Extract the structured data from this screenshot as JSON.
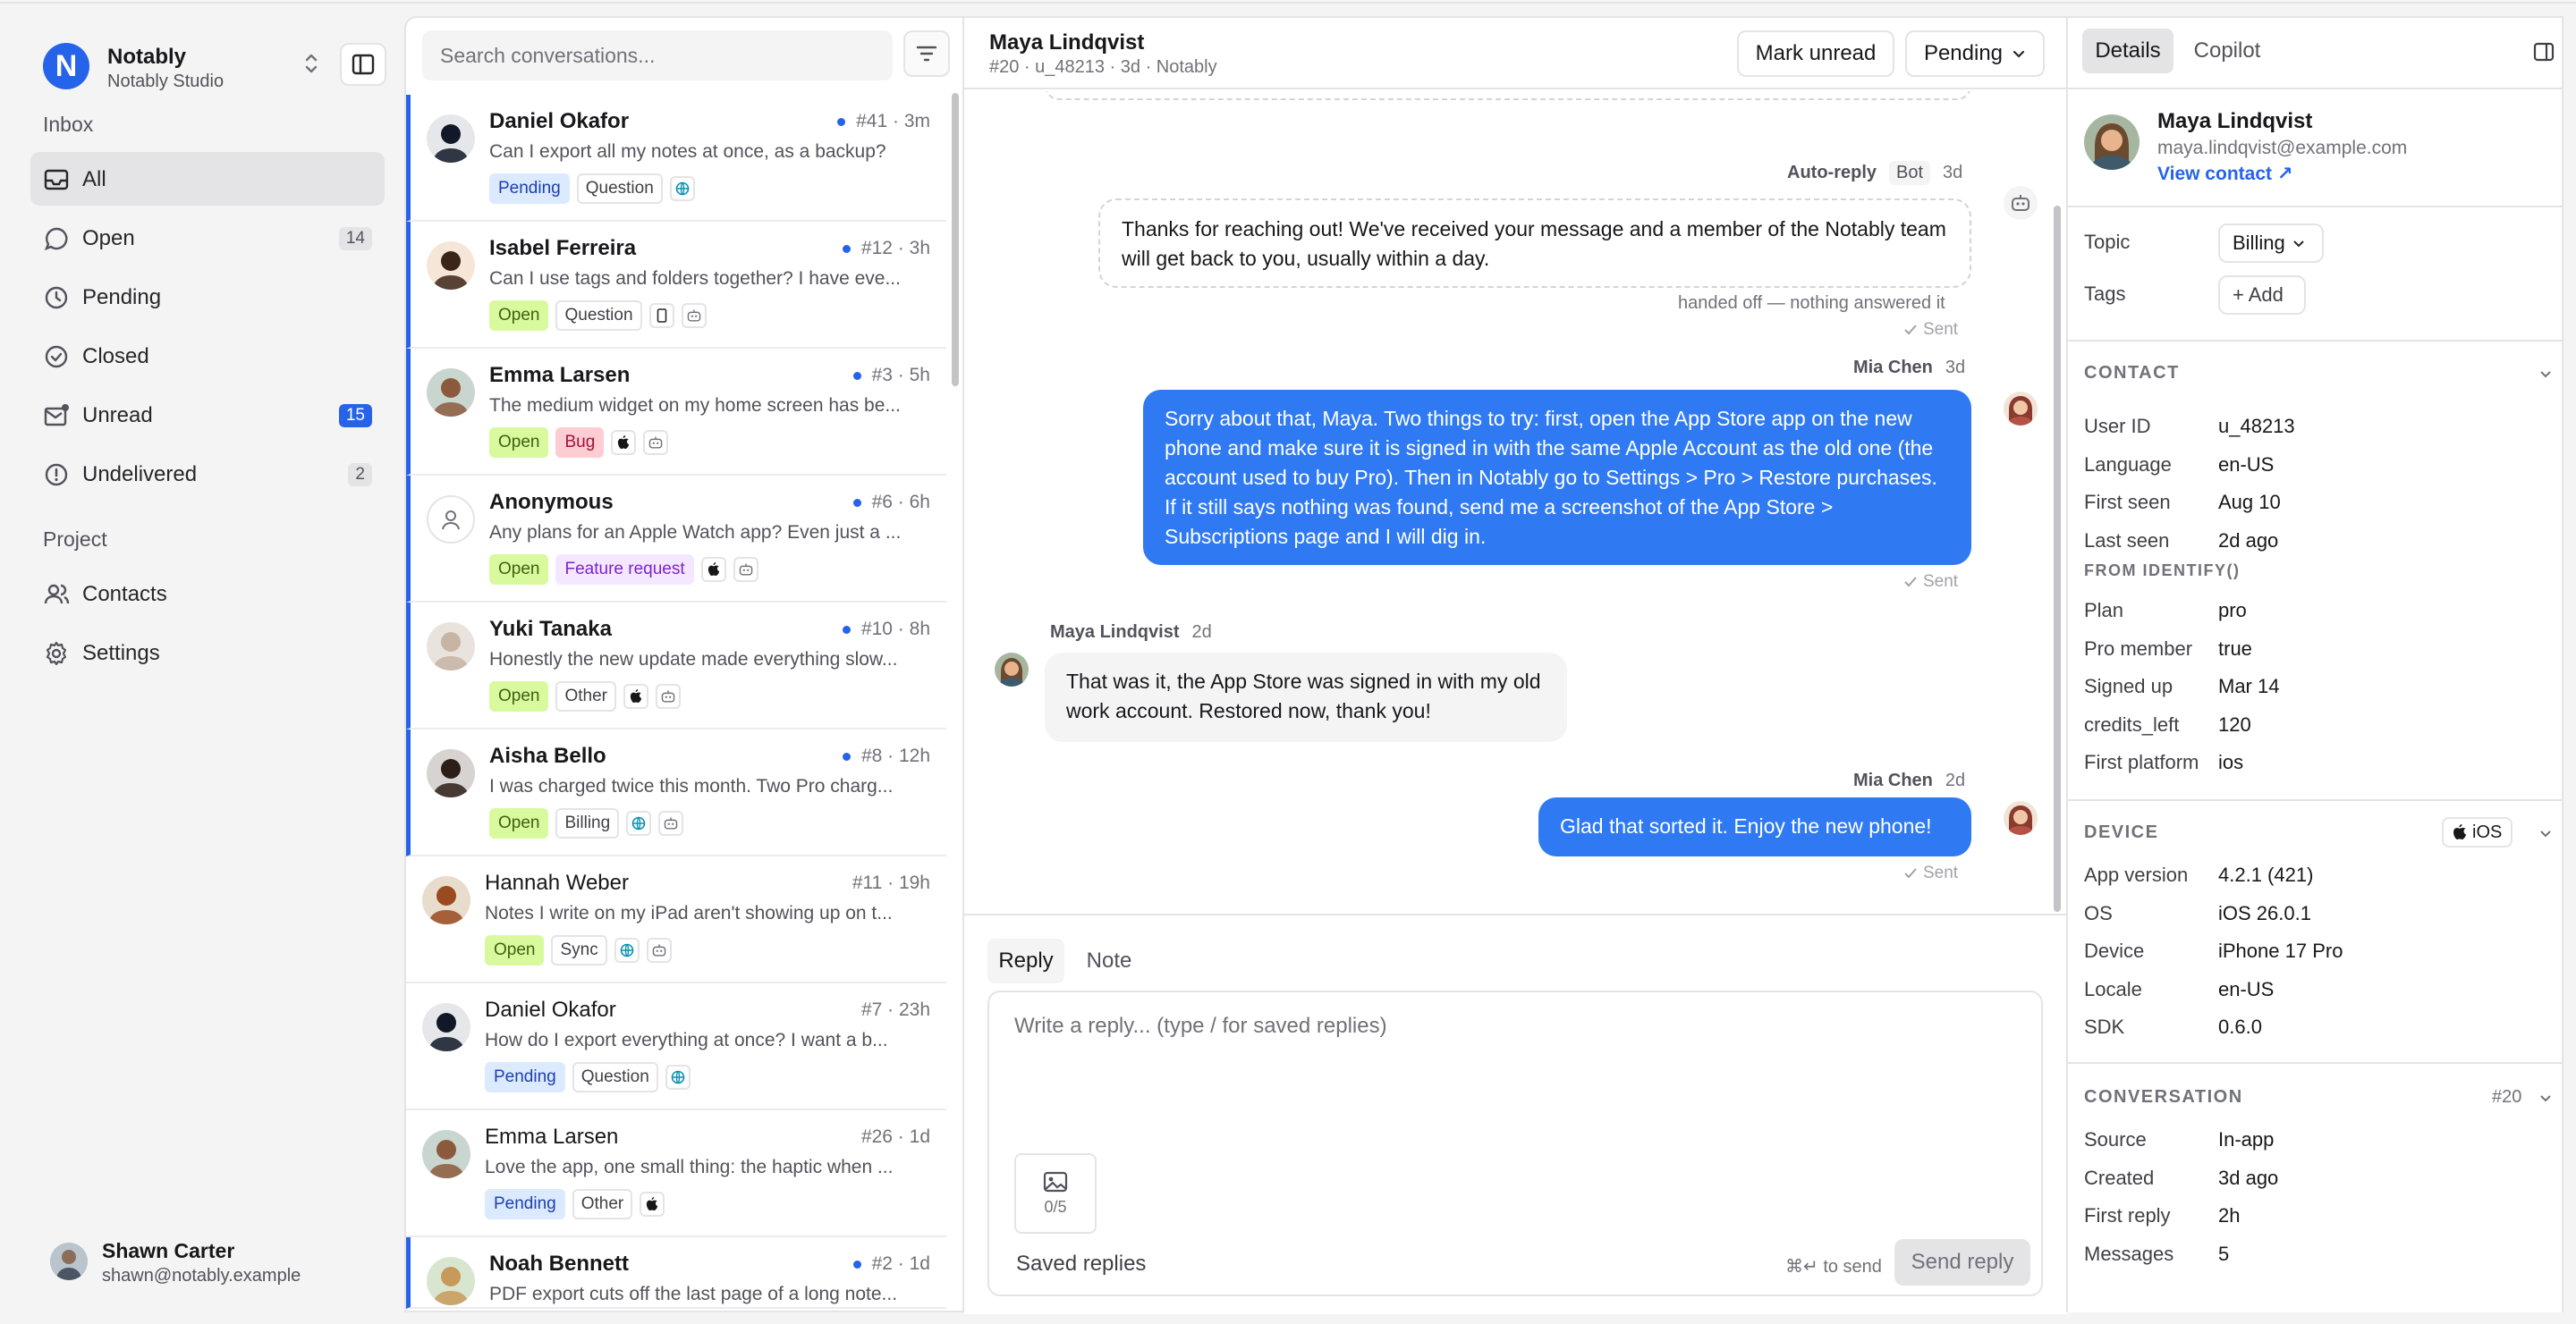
{
  "workspace": {
    "logo_letter": "N",
    "name": "Notably",
    "subtitle": "Notably Studio"
  },
  "sidebar": {
    "inbox_label": "Inbox",
    "items": [
      {
        "label": "All",
        "count": ""
      },
      {
        "label": "Open",
        "count": "14"
      },
      {
        "label": "Pending",
        "count": ""
      },
      {
        "label": "Closed",
        "count": ""
      },
      {
        "label": "Unread",
        "count": "15"
      },
      {
        "label": "Undelivered",
        "count": "2"
      }
    ],
    "project_label": "Project",
    "project_items": [
      {
        "label": "Contacts"
      },
      {
        "label": "Settings"
      }
    ],
    "user": {
      "name": "Shawn Carter",
      "email": "shawn@notably.example"
    }
  },
  "search": {
    "placeholder": "Search conversations..."
  },
  "conversations": [
    {
      "name": "Daniel Okafor",
      "meta": "#41 · 3m",
      "preview": "Can I export all my notes at once, as a backup?",
      "status": "Pending",
      "topic": "Question"
    },
    {
      "name": "Isabel Ferreira",
      "meta": "#12 · 3h",
      "preview": "Can I use tags and folders together? I have eve...",
      "status": "Open",
      "topic": "Question"
    },
    {
      "name": "Emma Larsen",
      "meta": "#3 · 5h",
      "preview": "The medium widget on my home screen has be...",
      "status": "Open",
      "topic": "Bug"
    },
    {
      "name": "Anonymous",
      "meta": "#6 · 6h",
      "preview": "Any plans for an Apple Watch app? Even just a ...",
      "status": "Open",
      "topic": "Feature request"
    },
    {
      "name": "Yuki Tanaka",
      "meta": "#10 · 8h",
      "preview": "Honestly the new update made everything slow...",
      "status": "Open",
      "topic": "Other"
    },
    {
      "name": "Aisha Bello",
      "meta": "#8 · 12h",
      "preview": "I was charged twice this month. Two Pro charg...",
      "status": "Open",
      "topic": "Billing"
    },
    {
      "name": "Hannah Weber",
      "meta": "#11 · 19h",
      "preview": "Notes I write on my iPad aren't showing up on t...",
      "status": "Open",
      "topic": "Sync"
    },
    {
      "name": "Daniel Okafor",
      "meta": "#7 · 23h",
      "preview": "How do I export everything at once? I want a b...",
      "status": "Pending",
      "topic": "Question"
    },
    {
      "name": "Emma Larsen",
      "meta": "#26 · 1d",
      "preview": "Love the app, one small thing: the haptic when ...",
      "status": "Pending",
      "topic": "Other"
    },
    {
      "name": "Noah Bennett",
      "meta": "#2 · 1d",
      "preview": "PDF export cuts off the last page of a long note...",
      "status": "",
      "topic": ""
    }
  ],
  "chat": {
    "title": "Maya Lindqvist",
    "subtitle": "#20 · u_48213 · 3d · Notably",
    "mark_unread": "Mark unread",
    "status": "Pending",
    "auto_label": "Auto-reply",
    "bot_badge": "Bot",
    "auto_time": "3d",
    "auto_text": "Thanks for reaching out! We've received your message and a member of the Notably team will get back to you, usually within a day.",
    "handoff_note": "handed off — nothing answered it",
    "sent": "Sent",
    "agent_name": "Mia Chen",
    "agent_time1": "3d",
    "agent_text1": "Sorry about that, Maya. Two things to try: first, open the App Store app on the new phone and make sure it is signed in with the same Apple Account as the old one (the account used to buy Pro). Then in Notably go to Settings > Pro > Restore purchases. If it still says nothing was found, send me a screenshot of the App Store > Subscriptions page and I will dig in.",
    "user_name": "Maya Lindqvist",
    "user_time": "2d",
    "user_text": "That was it, the App Store was signed in with my old work account. Restored now, thank you!",
    "agent_time2": "2d",
    "agent_text2": "Glad that sorted it. Enjoy the new phone!"
  },
  "composer": {
    "tab_reply": "Reply",
    "tab_note": "Note",
    "placeholder": "Write a reply... (type / for saved replies)",
    "attach_count": "0/5",
    "saved_replies": "Saved replies",
    "send_hint": "⌘↵ to send",
    "send_label": "Send reply"
  },
  "details": {
    "tab_details": "Details",
    "tab_copilot": "Copilot",
    "contact_name": "Maya Lindqvist",
    "contact_email": "maya.lindqvist@example.com",
    "view_contact": "View contact ↗",
    "topic_label": "Topic",
    "topic_value": "Billing",
    "tags_label": "Tags",
    "add_tag": "+ Add",
    "contact_section": "CONTACT",
    "contact_rows": [
      {
        "k": "User ID",
        "v": "u_48213"
      },
      {
        "k": "Language",
        "v": "en-US"
      },
      {
        "k": "First seen",
        "v": "Aug 10"
      },
      {
        "k": "Last seen",
        "v": "2d ago"
      }
    ],
    "identify_section": "FROM IDENTIFY()",
    "identify_rows": [
      {
        "k": "Plan",
        "v": "pro"
      },
      {
        "k": "Pro member",
        "v": "true"
      },
      {
        "k": "Signed up",
        "v": "Mar 14"
      },
      {
        "k": "credits_left",
        "v": "120"
      },
      {
        "k": "First platform",
        "v": "ios"
      }
    ],
    "device_section": "DEVICE",
    "device_badge": "iOS",
    "device_rows": [
      {
        "k": "App version",
        "v": "4.2.1 (421)"
      },
      {
        "k": "OS",
        "v": "iOS 26.0.1"
      },
      {
        "k": "Device",
        "v": "iPhone 17 Pro"
      },
      {
        "k": "Locale",
        "v": "en-US"
      },
      {
        "k": "SDK",
        "v": "0.6.0"
      }
    ],
    "conversation_section": "CONVERSATION",
    "conversation_id": "#20",
    "conversation_rows": [
      {
        "k": "Source",
        "v": "In-app"
      },
      {
        "k": "Created",
        "v": "3d ago"
      },
      {
        "k": "First reply",
        "v": "2h"
      },
      {
        "k": "Messages",
        "v": "5"
      }
    ]
  },
  "colors": {
    "accent": "#2563eb",
    "agent_bubble": "#2f7af3",
    "pending_tag": "#dbeafe",
    "open_tag": "#d9f99d",
    "bug_tag": "#fecdd3",
    "feature_tag": "#f3e8ff"
  }
}
